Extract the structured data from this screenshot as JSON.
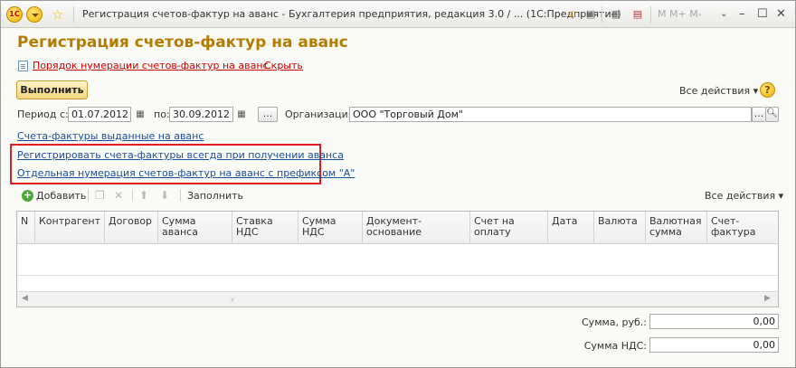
{
  "titlebar": {
    "title": "Регистрация счетов-фактур на аванс - Бухгалтерия предприятия, редакция 3.0 / ...  (1С:Предприятие)",
    "logo_text": "1С",
    "m_buttons": "M  M+  M-"
  },
  "page": {
    "heading": "Регистрация счетов-фактур на аванс",
    "numbering_link": "Порядок нумерации счетов-фактур на аванс",
    "hide_link": "Скрыть"
  },
  "toolbar": {
    "run_label": "Выполнить",
    "all_actions": "Все действия ▾",
    "help": "?"
  },
  "period": {
    "label_from": "Период с:",
    "from_value": "01.07.2012",
    "label_to": "по:",
    "to_value": "30.09.2012",
    "dots": "...",
    "org_label": "Организация:",
    "org_value": "ООО \"Торговый Дом\"",
    "org_dots": "..."
  },
  "links": {
    "issued": "Счета-фактуры выданные на аванс",
    "always_register": "Регистрировать счета-фактуры всегда при получении аванса",
    "separate_numbering": "Отдельная нумерация счетов-фактур на аванс с префиксом \"А\""
  },
  "table_toolbar": {
    "add": "Добавить",
    "fill": "Заполнить",
    "all_actions": "Все действия ▾"
  },
  "table": {
    "columns": [
      "N",
      "Контрагент",
      "Договор",
      "Сумма аванса",
      "Ставка НДС",
      "Сумма НДС",
      "Документ-основание",
      "Счет на оплату",
      "Дата",
      "Валюта",
      "Валютная сумма",
      "Счет-фактура"
    ]
  },
  "totals": {
    "sum_label": "Сумма, руб.:",
    "sum_value": "0,00",
    "vat_label": "Сумма НДС:",
    "vat_value": "0,00"
  }
}
